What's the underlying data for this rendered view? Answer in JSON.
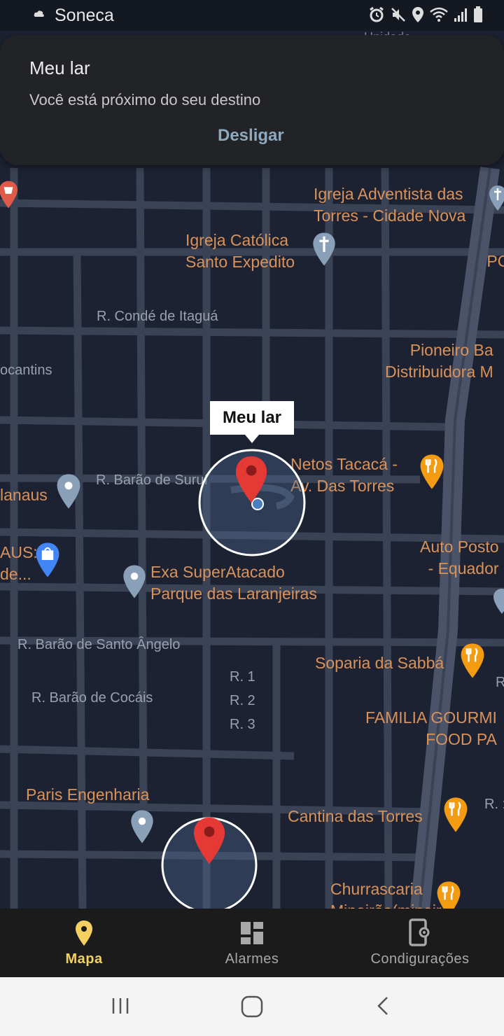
{
  "status_bar": {
    "app_name": "Soneca",
    "icons": [
      "cloud-icon",
      "alarm-icon",
      "mute-icon",
      "location-icon",
      "wifi-icon",
      "signal-icon",
      "battery-icon"
    ]
  },
  "notification": {
    "title": "Meu lar",
    "message": "Você está próximo do seu destino",
    "dismiss_label": "Desligar"
  },
  "map": {
    "marker_label": "Meu lar",
    "pois": {
      "igreja_adventista": "Igreja Adventista das\nTorres - Cidade Nova",
      "igreja_catolica": "Igreja Católica\nSanto Expedito",
      "post": "POST\n- C",
      "pioneiro": "Pioneiro Ba\nDistribuidora M",
      "netos_tacaca": "Netos Tacacá -\nAv. Das Torres",
      "manaus": "lanaus",
      "aus": "AUS:\nde...",
      "auto_posto": "Auto Posto\n- Equador",
      "exa": "Exa SuperAtacado\nParque das Laranjeiras",
      "soparia": "Soparia da Sabbá",
      "familia": "FAMILIA GOURMI\nFOOD PA",
      "paris": "Paris Engenharia",
      "cantina": "Cantina das Torres",
      "churrascaria": "Churrascaria\nMineirão(mineiro)",
      "upper_cut": "U",
      "top_cut": "Unidade"
    },
    "streets": {
      "conde": "R. Condé de Itaguá",
      "tocantins": "ocantins",
      "barao_surui": "R. Barão de Suruí",
      "santo_angelo": "R. Barão de Santo Ângelo",
      "r1": "R. 1",
      "r2": "R. 2",
      "r3": "R. 3",
      "cocais": "R. Barão de Cocáis",
      "r_cut": "R",
      "r_dot": "R. :"
    }
  },
  "bottom_nav": {
    "items": [
      {
        "label": "Mapa",
        "icon": "map-pin-icon",
        "active": true
      },
      {
        "label": "Alarmes",
        "icon": "dashboard-icon",
        "active": false
      },
      {
        "label": "Condigurações",
        "icon": "device-settings-icon",
        "active": false
      }
    ]
  },
  "colors": {
    "accent": "#f3d05f",
    "map_bg": "#1d2233",
    "poi_text": "#d9925a",
    "notif_button": "#8ea8be",
    "marker": "#e53935"
  }
}
